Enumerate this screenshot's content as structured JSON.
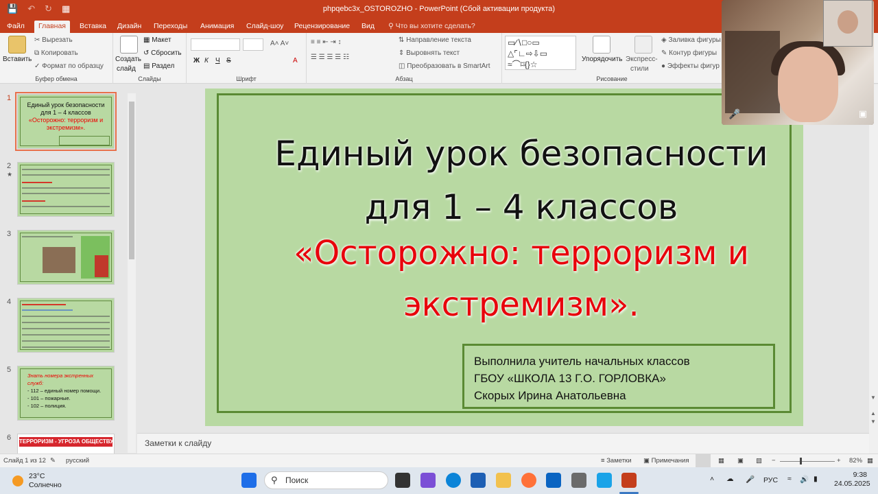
{
  "window": {
    "title": "phpqebc3x_OSTOROZHO - PowerPoint (Сбой активации продукта)",
    "qat": {
      "save_icon": "save-icon",
      "undo_icon": "undo-icon",
      "redo_icon": "redo-icon",
      "present_icon": "present-icon"
    }
  },
  "ribbon_tabs": [
    "Файл",
    "Главная",
    "Вставка",
    "Дизайн",
    "Переходы",
    "Анимация",
    "Слайд-шоу",
    "Рецензирование",
    "Вид"
  ],
  "tell_me": "Что вы хотите сделать?",
  "ribbon": {
    "clipboard": {
      "label": "Буфер обмена",
      "paste": "Вставить",
      "cut": "Вырезать",
      "copy": "Копировать",
      "format_painter": "Формат по образцу"
    },
    "slides": {
      "label": "Слайды",
      "new_slide_1": "Создать",
      "new_slide_2": "слайд",
      "layout": "Макет",
      "reset": "Сбросить",
      "section": "Раздел"
    },
    "font": {
      "label": "Шрифт",
      "bold": "Ж",
      "italic": "К",
      "underline": "Ч",
      "strike": "S",
      "font_color": "A"
    },
    "paragraph": {
      "label": "Абзац",
      "text_direction": "Направление текста",
      "align_text": "Выровнять текст",
      "smartart": "Преобразовать в SmartArt"
    },
    "drawing": {
      "label": "Рисование",
      "arrange": "Упорядочить",
      "quick_styles_1": "Экспресс-",
      "quick_styles_2": "стили",
      "shape_fill": "Заливка фигуры",
      "shape_outline": "Контур фигуры",
      "shape_effects": "Эффекты фигур"
    }
  },
  "thumbnails": [
    {
      "num": "1",
      "lines": [
        "Единый урок безопасности",
        "для 1 – 4 классов",
        "«Осторожно: терроризм и",
        "экстремизм»."
      ]
    },
    {
      "num": "2",
      "star": "★"
    },
    {
      "num": "3"
    },
    {
      "num": "4"
    },
    {
      "num": "5",
      "lines": [
        "Знать номера экстренных",
        "служб:",
        "- 112 – единый номер помощи.",
        "- 101 – пожарные.",
        "- 102 – полиция."
      ]
    },
    {
      "num": "6",
      "lines": [
        "ТЕРРОРИЗМ - УГРОЗА ОБЩЕСТВУ"
      ]
    }
  ],
  "slide": {
    "title_line1": "Единый урок безопасности",
    "title_line2": "для 1 – 4 классов",
    "subtitle_line1": "«Осторожно: терроризм и",
    "subtitle_line2": "экстремизм».",
    "author_line1": "Выполнила учитель начальных классов",
    "author_line2": "ГБОУ «ШКОЛА 13 Г.О. ГОРЛОВКА»",
    "author_line3": "Скорых Ирина Анатольевна",
    "colors": {
      "background": "#b8d9a2",
      "frame": "#5a8a33",
      "subtitle": "#e8000b"
    }
  },
  "notes_placeholder": "Заметки к слайду",
  "status": {
    "slide_count": "Слайд 1 из 12",
    "language": "русский",
    "notes": "Заметки",
    "comments": "Примечания",
    "zoom": "82%"
  },
  "taskbar": {
    "temperature": "23°C",
    "weather": "Солнечно",
    "search_placeholder": "Поиск",
    "language": "РУС",
    "time": "9:38",
    "date": "24.05.2025"
  }
}
